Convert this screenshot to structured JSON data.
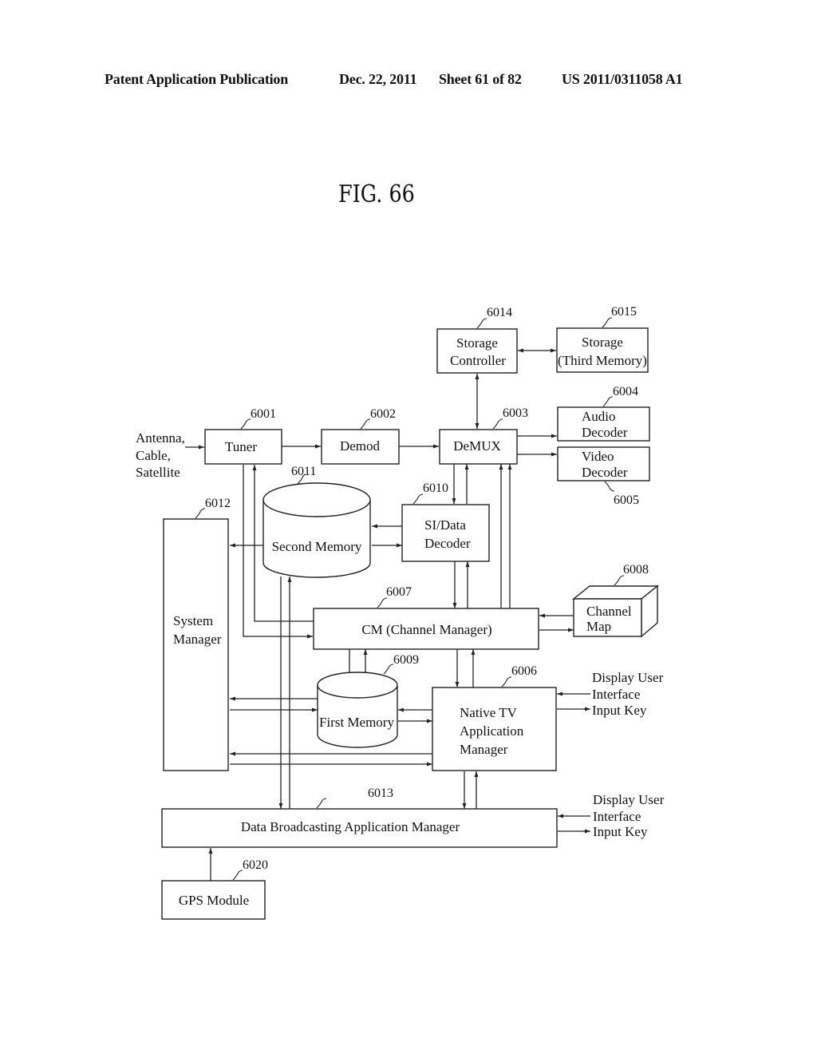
{
  "header": {
    "publication": "Patent Application Publication",
    "date": "Dec. 22, 2011",
    "sheet": "Sheet 61 of 82",
    "patent_number": "US 2011/0311058 A1"
  },
  "figure": {
    "title": "FIG. 66"
  },
  "blocks": {
    "tuner": {
      "ref": "6001",
      "lines": [
        "Tuner"
      ]
    },
    "demod": {
      "ref": "6002",
      "lines": [
        "Demod"
      ]
    },
    "demux": {
      "ref": "6003",
      "lines": [
        "DeMUX"
      ]
    },
    "audio_decoder": {
      "ref": "6004",
      "lines": [
        "Audio",
        "Decoder"
      ]
    },
    "video_decoder": {
      "ref": "6005",
      "lines": [
        "Video",
        "Decoder"
      ]
    },
    "native_tv_app_manager": {
      "ref": "6006",
      "lines": [
        "Native TV",
        "Application",
        "Manager"
      ]
    },
    "channel_manager": {
      "ref": "6007",
      "lines": [
        "CM (Channel Manager)"
      ]
    },
    "channel_map": {
      "ref": "6008",
      "lines": [
        "Channel",
        "Map"
      ]
    },
    "first_memory": {
      "ref": "6009",
      "lines": [
        "First Memory"
      ]
    },
    "si_data_decoder": {
      "ref": "6010",
      "lines": [
        "SI/Data",
        "Decoder"
      ]
    },
    "second_memory": {
      "ref": "6011",
      "lines": [
        "Second Memory"
      ]
    },
    "system_manager": {
      "ref": "6012",
      "lines": [
        "System",
        "Manager"
      ]
    },
    "data_broadcasting_app_manager": {
      "ref": "6013",
      "lines": [
        "Data Broadcasting Application Manager"
      ]
    },
    "storage_controller": {
      "ref": "6014",
      "lines": [
        "Storage",
        "Controller"
      ]
    },
    "storage_third_memory": {
      "ref": "6015",
      "lines": [
        "Storage",
        "(Third Memory)"
      ]
    },
    "gps_module": {
      "ref": "6020",
      "lines": [
        "GPS Module"
      ]
    }
  },
  "external_labels": {
    "input_source": [
      "Antenna,",
      "Cable,",
      "Satellite"
    ],
    "ui_native": [
      "Display User",
      "Interface",
      "Input Key"
    ],
    "ui_data": [
      "Display User",
      "Interface",
      "Input Key"
    ]
  }
}
